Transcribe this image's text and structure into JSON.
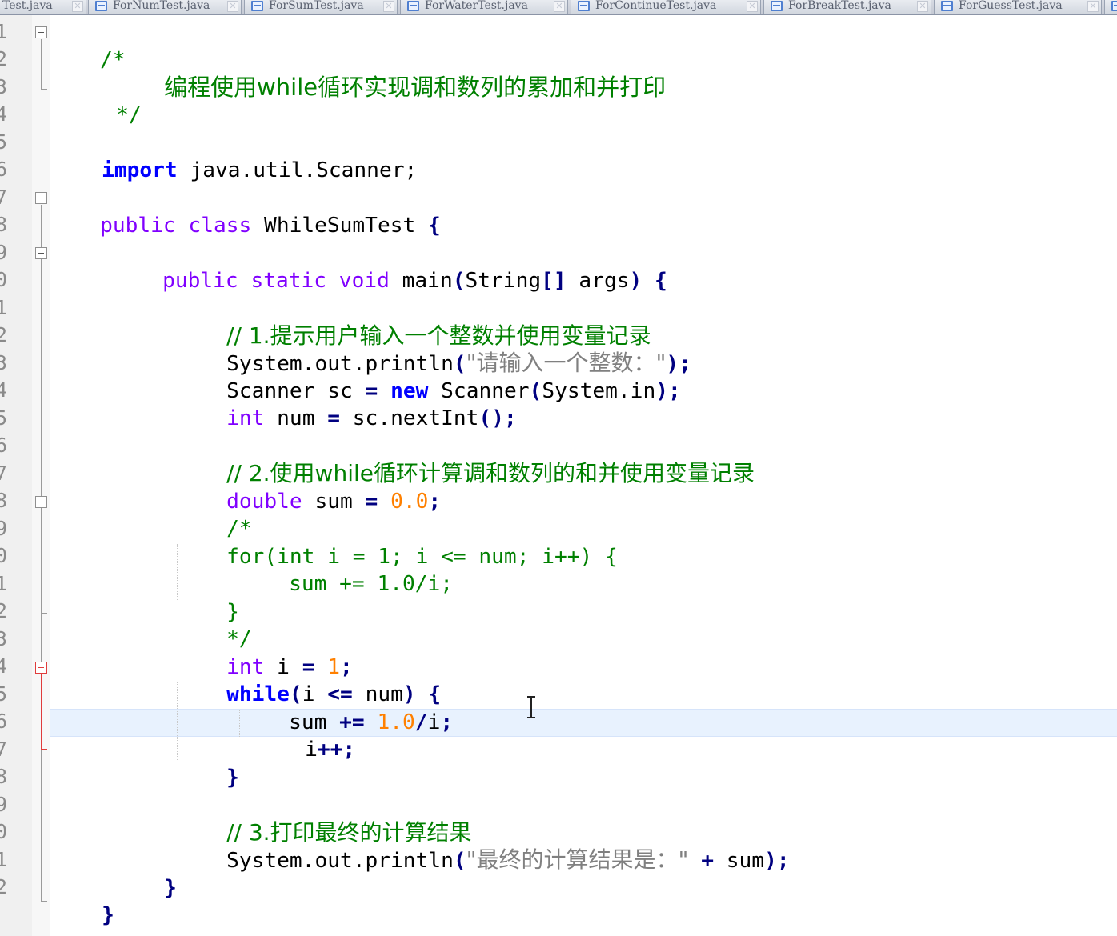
{
  "tabs": [
    {
      "label": "Test.java"
    },
    {
      "label": "ForNumTest.java"
    },
    {
      "label": "ForSumTest.java"
    },
    {
      "label": "ForWaterTest.java"
    },
    {
      "label": "ForContinueTest.java"
    },
    {
      "label": "ForBreakTest.java"
    },
    {
      "label": "ForGuessTest.java"
    }
  ],
  "gutter": {
    "line_numbers": [
      "1",
      "2",
      "3",
      "4",
      "5",
      "6",
      "7",
      "8",
      "9",
      "0",
      "1",
      "2",
      "3",
      "4",
      "5",
      "6",
      "7",
      "8",
      "9",
      "0",
      "1",
      "2",
      "3",
      "4",
      "5",
      "6",
      "7",
      "8",
      "9",
      "0",
      "1",
      "2"
    ]
  },
  "code": {
    "l1": {
      "t1": "/*"
    },
    "l2": {
      "t1": "编程使用while循环实现调和数列的累加和并打印"
    },
    "l3": {
      "t1": "*/"
    },
    "l5": {
      "t1": "import",
      "t2": " java.util.Scanner;"
    },
    "l7": {
      "t1": "public class",
      "t2": " WhileSumTest ",
      "t3": "{"
    },
    "l9": {
      "t1": "public static void",
      "t2": " main",
      "t3": "(",
      "t4": "String",
      "t5": "[]",
      "t6": " args",
      "t7": ")",
      "t8": " {"
    },
    "l11": {
      "t1": "// 1.提示用户输入一个整数并使用变量记录"
    },
    "l12": {
      "t1": "System.out.println",
      "t2": "(",
      "t3": "\"请输入一个整数：\"",
      "t4": ");"
    },
    "l13": {
      "t1": "Scanner sc ",
      "t2": "=",
      "t3": " ",
      "t4": "new",
      "t5": " Scanner",
      "t6": "(",
      "t7": "System.in",
      "t8": ");"
    },
    "l14": {
      "t1": "int",
      "t2": " num ",
      "t3": "=",
      "t4": " sc.nextInt",
      "t5": "();"
    },
    "l16": {
      "t1": "// 2.使用while循环计算调和数列的和并使用变量记录"
    },
    "l17": {
      "t1": "double",
      "t2": " sum ",
      "t3": "=",
      "t4": " ",
      "t5": "0.0",
      "t6": ";"
    },
    "l18": {
      "t1": "/*"
    },
    "l19": {
      "t1": "for(int i = 1; i <= num; i++) {"
    },
    "l20": {
      "t1": "sum += 1.0/i;"
    },
    "l21": {
      "t1": "}"
    },
    "l22": {
      "t1": "*/"
    },
    "l23": {
      "t1": "int",
      "t2": " i ",
      "t3": "=",
      "t4": " ",
      "t5": "1",
      "t6": ";"
    },
    "l24": {
      "t1": "while",
      "t2": "(",
      "t3": "i ",
      "t4": "<=",
      "t5": " num",
      "t6": ")",
      "t7": " {"
    },
    "l25": {
      "t1": "sum ",
      "t2": "+=",
      "t3": " ",
      "t4": "1.0",
      "t5": "/",
      "t6": "i",
      "t7": ";"
    },
    "l26": {
      "t1": "i",
      "t2": "++;"
    },
    "l27": {
      "t1": "}"
    },
    "l29": {
      "t1": "// 3.打印最终的计算结果"
    },
    "l30": {
      "t1": "System.out.println",
      "t2": "(",
      "t3": "\"最终的计算结果是：\"",
      "t4": " ",
      "t5": "+",
      "t6": " sum",
      "t7": ");"
    },
    "l31": {
      "t1": "}"
    },
    "l32": {
      "t1": "}"
    }
  },
  "colors": {
    "keyword": "#0000ff",
    "type_keyword": "#8000ff",
    "comment": "#008000",
    "number": "#ff8000",
    "string": "#808080",
    "operator": "#000080",
    "current_line": "#e8f2fe"
  }
}
